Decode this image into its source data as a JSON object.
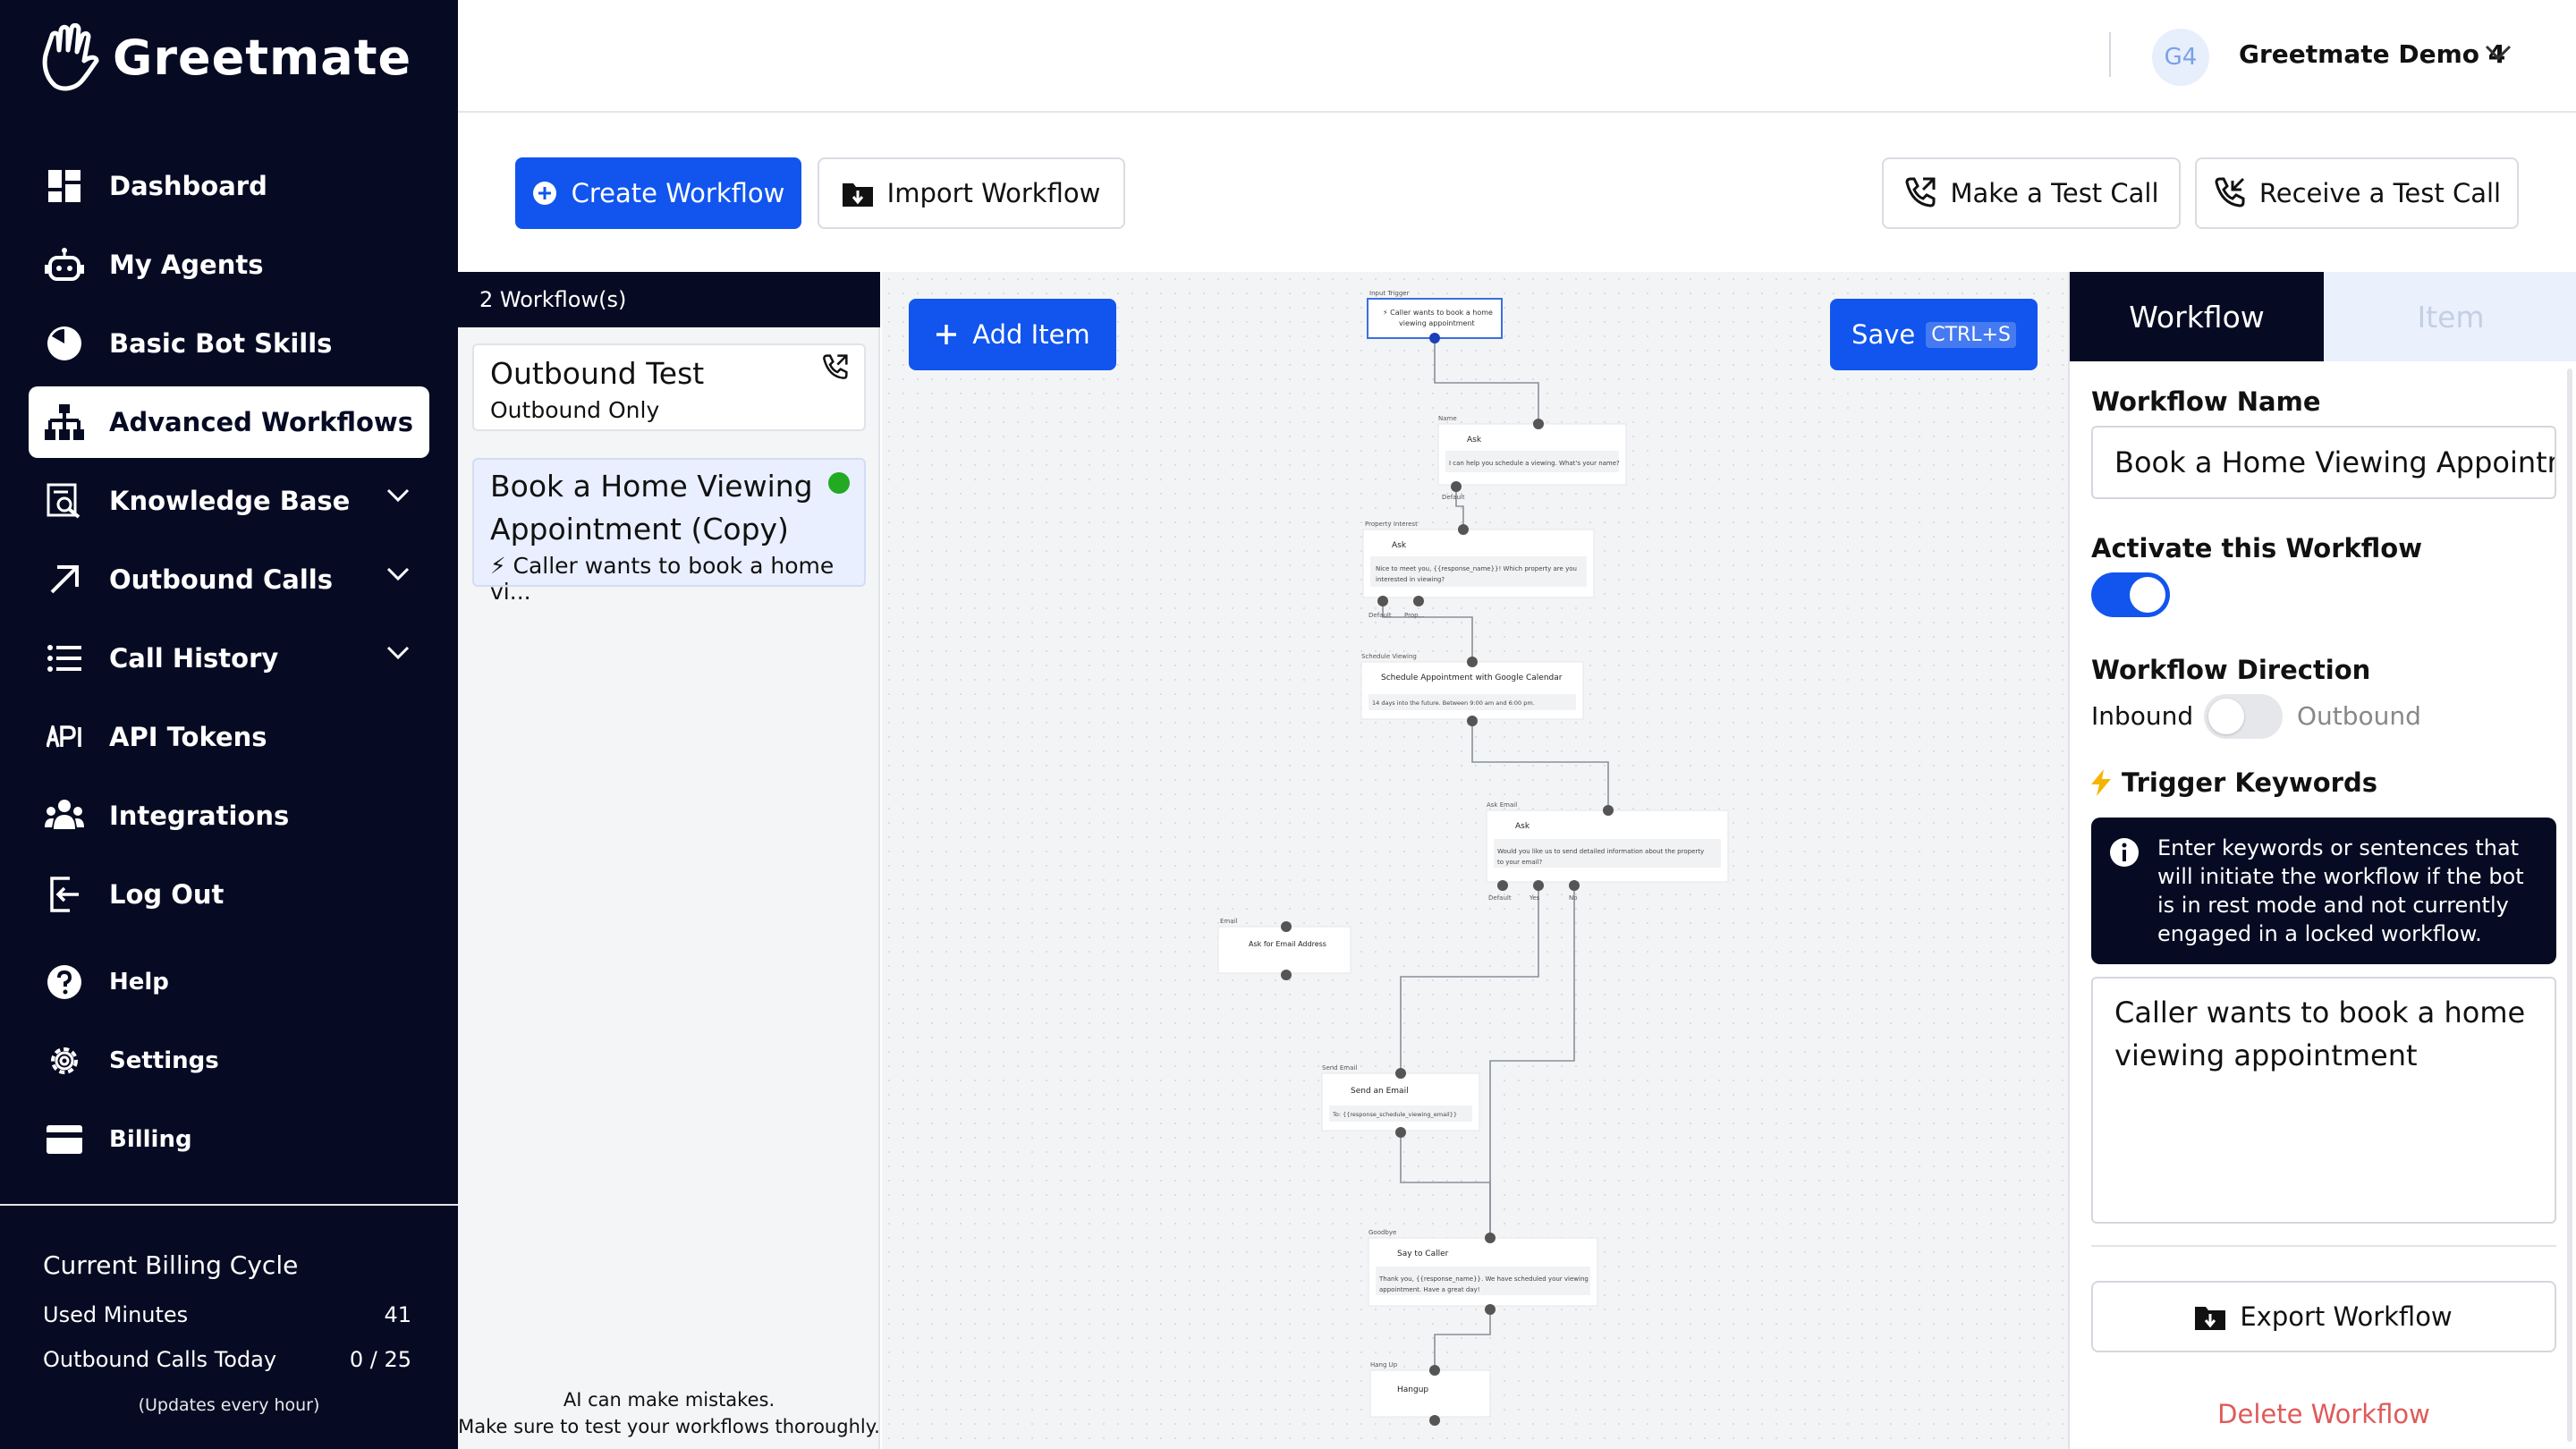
{
  "brand": {
    "name": "Greetmate"
  },
  "sidebar": {
    "items": [
      {
        "label": "Dashboard",
        "icon": "dashboard-icon"
      },
      {
        "label": "My Agents",
        "icon": "robot-icon"
      },
      {
        "label": "Basic Bot Skills",
        "icon": "clock-pie-icon"
      },
      {
        "label": "Advanced Workflows",
        "icon": "sitemap-icon",
        "active": true
      },
      {
        "label": "Knowledge Base",
        "icon": "search-doc-icon",
        "expandable": true
      },
      {
        "label": "Outbound Calls",
        "icon": "arrow-up-right-icon",
        "expandable": true
      },
      {
        "label": "Call History",
        "icon": "list-icon",
        "expandable": true
      },
      {
        "label": "API Tokens",
        "icon": "api-icon"
      },
      {
        "label": "Integrations",
        "icon": "people-icon"
      },
      {
        "label": "Log Out",
        "icon": "logout-icon"
      },
      {
        "label": "Help",
        "icon": "help-icon"
      },
      {
        "label": "Settings",
        "icon": "gear-icon"
      },
      {
        "label": "Billing",
        "icon": "card-icon"
      }
    ],
    "billing": {
      "title": "Current Billing Cycle",
      "used_minutes_label": "Used Minutes",
      "used_minutes_value": "41",
      "outbound_label": "Outbound Calls Today",
      "outbound_value": "0 / 25",
      "note": "(Updates every hour)"
    }
  },
  "header": {
    "avatar_initials": "G4",
    "account_name": "Greetmate Demo 4"
  },
  "toolbar": {
    "create": "Create Workflow",
    "import": "Import Workflow",
    "test_call": "Make a Test Call",
    "receive_call": "Receive a Test Call"
  },
  "workflows": {
    "count_label": "2 Workflow(s)",
    "items": [
      {
        "title": "Outbound Test",
        "subtitle": "Outbound Only"
      },
      {
        "title_line1": "Book a Home Viewing",
        "title_line2": "Appointment (Copy)",
        "subtitle": "⚡ Caller wants to book a home vi..."
      }
    ],
    "note_line1": "AI can make mistakes.",
    "note_line2": "Make sure to test your workflows thoroughly."
  },
  "canvas": {
    "add_item": "Add Item",
    "save": "Save",
    "save_shortcut": "CTRL+S",
    "nodes": {
      "trigger": {
        "caption": "Input Trigger",
        "line1": "⚡ Caller wants to book a home",
        "line2": "viewing appointment"
      },
      "ask_name": {
        "caption": "Name",
        "title": "Ask",
        "body": "I can help you schedule a viewing. What's your name?",
        "out1": "Default"
      },
      "ask_property": {
        "caption": "Property Interest",
        "title": "Ask",
        "body1": "Nice to meet you, {{response_name}}! Which property are you",
        "body2": "interested in viewing?",
        "out1": "Default",
        "out2": "Prop..."
      },
      "schedule": {
        "caption": "Schedule Viewing",
        "title": "Schedule Appointment with Google Calendar",
        "body": "14 days into the future. Between 9:00 am and 6:00 pm."
      },
      "ask_email": {
        "caption": "Ask Email",
        "title": "Ask",
        "body1": "Would you like us to send detailed information about the property",
        "body2": "to your email?",
        "out1": "Default",
        "out2": "Yes",
        "out3": "No"
      },
      "email": {
        "caption": "Email",
        "title": "Ask for Email Address"
      },
      "send_email": {
        "caption": "Send Email",
        "title": "Send an Email",
        "body": "To: {{response_schedule_viewing_email}}"
      },
      "goodbye": {
        "caption": "Goodbye",
        "title": "Say to Caller",
        "body1": "Thank you, {{response_name}}. We have scheduled your viewing",
        "body2": "appointment. Have a great day!"
      },
      "hangup": {
        "caption": "Hang Up",
        "title": "Hangup"
      }
    }
  },
  "panel": {
    "tab_workflow": "Workflow",
    "tab_item": "Item",
    "name_label": "Workflow Name",
    "name_value": "Book a Home Viewing Appointment (Copy)",
    "activate_label": "Activate this Workflow",
    "activate_on": true,
    "direction_label": "Workflow Direction",
    "inbound": "Inbound",
    "outbound": "Outbound",
    "direction_outbound": false,
    "trigger_label": "Trigger Keywords",
    "info_text": "Enter keywords or sentences that will initiate the workflow if the bot is in rest mode and not currently engaged in a locked workflow.",
    "trigger_value": "Caller wants to book a home viewing appointment",
    "export": "Export Workflow",
    "delete": "Delete Workflow"
  },
  "colors": {
    "navy": "#060b23",
    "primary": "#1155ee",
    "active_dot": "#22aa22",
    "danger": "#e05a5a"
  }
}
